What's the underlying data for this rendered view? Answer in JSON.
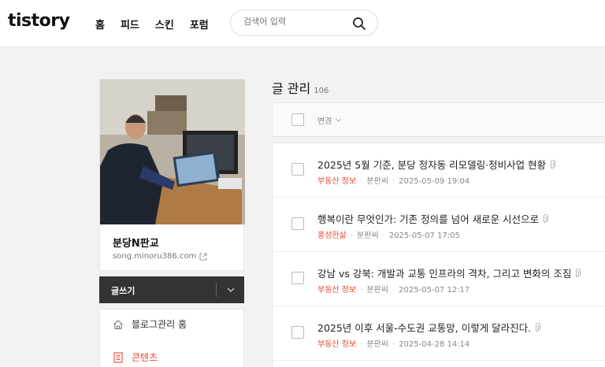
{
  "header": {
    "logo": "tistory",
    "nav": [
      "홈",
      "피드",
      "스킨",
      "포럼"
    ],
    "search_placeholder": "검색어 입력"
  },
  "sidebar": {
    "blog_name": "분당N판교",
    "blog_url": "song.minoru386.com",
    "write_label": "글쓰기",
    "menu": [
      {
        "label": "블로그관리 홈"
      },
      {
        "label": "콘텐츠"
      }
    ]
  },
  "main": {
    "title": "글 관리",
    "count": "106",
    "toolbar_change": "변경",
    "posts": [
      {
        "title": "2025년 5월 기준, 분당 정자동 리모델링·정비사업 현황",
        "category": "부동산 정보",
        "author": "분판씨",
        "date": "2025-05-09 19:04"
      },
      {
        "title": "행복이란 무엇인가: 기존 정의를 넘어 새로운 시선으로",
        "category": "풍성한삶",
        "author": "분판씨",
        "date": "2025-05-07 17:05"
      },
      {
        "title": "강남 vs 강북: 개발과 교통 인프라의 격차, 그리고 변화의 조짐",
        "category": "부동산 정보",
        "author": "분판씨",
        "date": "2025-05-07 12:17"
      },
      {
        "title": "2025년 이후 서울-수도권 교통망, 이렇게 달라진다.",
        "category": "부동산 정보",
        "author": "분판씨",
        "date": "2025-04-28 14:14"
      }
    ]
  },
  "colors": {
    "accent": "#e8482f",
    "write_bg": "#333333"
  }
}
